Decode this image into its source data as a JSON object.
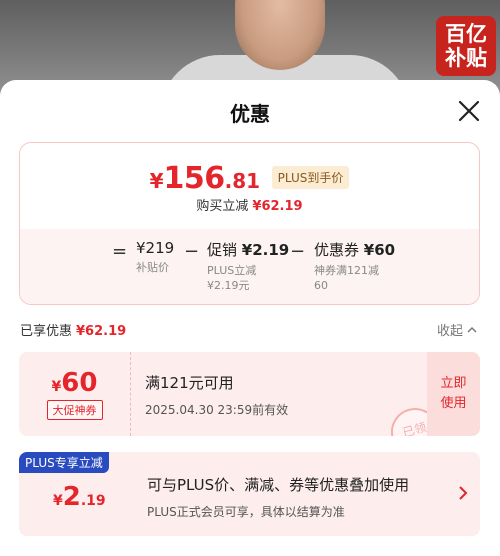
{
  "promo_badge": {
    "line1": "百亿",
    "line2": "补贴"
  },
  "sheet": {
    "title": "优惠"
  },
  "summary": {
    "price_currency": "¥",
    "price_integer": "156",
    "price_decimal": ".81",
    "price_tag": "PLUS到手价",
    "save_label": "购买立减",
    "save_amount": "¥62.19",
    "formula": {
      "equals": "=",
      "minus": "−",
      "base_price": "¥219",
      "base_label": "补贴价",
      "promo_title": "促销",
      "promo_value": "¥2.19",
      "promo_sub1": "PLUS立减",
      "promo_sub2": "¥2.19元",
      "coupon_title": "优惠券",
      "coupon_value": "¥60",
      "coupon_sub1": "神券满121减",
      "coupon_sub2": "60"
    }
  },
  "enjoyed": {
    "label": "已享优惠",
    "amount": "¥62.19",
    "collapse_label": "收起"
  },
  "coupon": {
    "currency": "¥",
    "value": "60",
    "kind": "大促神券",
    "condition": "满121元可用",
    "expiry": "2025.04.30 23:59前有效",
    "action_line1": "立即",
    "action_line2": "使用",
    "stamp": "已领"
  },
  "plus": {
    "badge": "PLUS专享立减",
    "currency": "¥",
    "value_int": "2",
    "value_dec": ".19",
    "desc": "可与PLUS价、满减、券等优惠叠加使用",
    "note": "PLUS正式会员可享，具体以结算为准"
  },
  "colors": {
    "accent": "#e4252b",
    "plus_blue": "#2a4bbf",
    "card_bg": "#fdeeed"
  },
  "icons": {
    "close": "close-icon",
    "chevron_up": "chevron-up-icon",
    "chevron_right": "chevron-right-icon"
  }
}
